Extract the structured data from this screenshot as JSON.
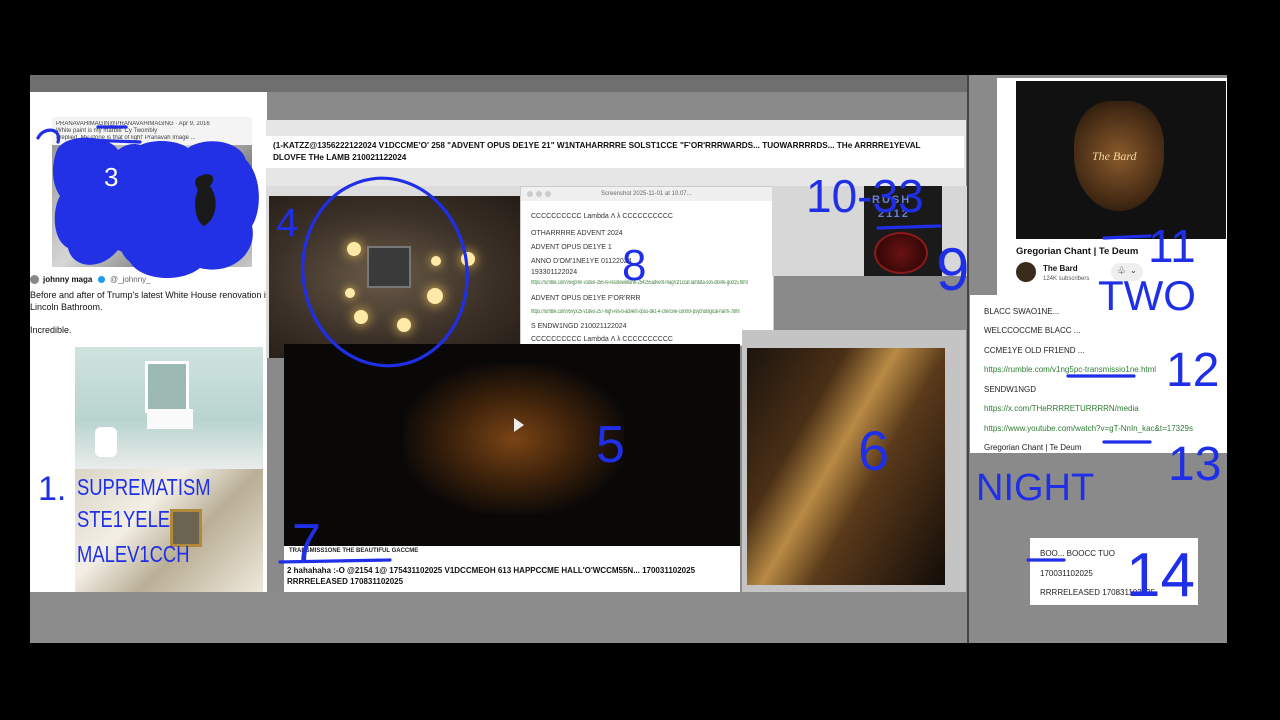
{
  "colors": {
    "ink": "#1f2fe8",
    "background": "#000000",
    "desktop": "#8a8a8a",
    "link": "#2e7d32"
  },
  "tweet_top": {
    "handle_line": "PRANAVAHIMAGIN@PRANAVAHIMAGING · Apr 9, 2016",
    "line1": "White paint is my marble' Cy Twombly",
    "line2": "I replied,  My stone is that of light' Pranavah Image ..."
  },
  "tweet_main": {
    "user": "johnny maga",
    "handle": "@_johnny_",
    "text_line1": "Before and after of Trump's latest White House renovation in",
    "text_line2": "Lincoln Bathroom.",
    "text_line3": "Incredible."
  },
  "suprematism": {
    "line1": "SUPREMATISM",
    "line2": "STE1YELE",
    "line3": "MALEV1CCH"
  },
  "title_banner": {
    "line1": "(1-KATZZ@1356222122024 V1DCCME'O' 258 \"ADVENT OPUS DE1YE 21\" W1NTAHARRRRE SOLST1CCE \"F'OR'RRRWARDS... TUOWARRRRDS... THe ARRRRE1YEVAL",
    "line2": "DLOVFE THe LAMB 210021122024"
  },
  "screenshot_title": "Screenshot 2025-11-01 at 10.07...",
  "notes": [
    {
      "text": "CCCCCCCCCC Lambda Λ λ CCCCCCCCCC",
      "link": false
    },
    {
      "text": "OTHARRRRE ADVENT 2024",
      "link": false
    },
    {
      "text": "ADVENT OPUS DE1YE 1",
      "link": false
    },
    {
      "text": "ANNO D'OM'1NE1YE 01122024",
      "link": false
    },
    {
      "text": "193301122024",
      "link": false
    },
    {
      "text": "https://rumble.com/v5vjpmn-v1deo-256-re-resolewetione-254255advent-magn1f1ccat-lambda-son-dlovfe-god15.html",
      "link": true
    },
    {
      "text": "ADVENT OPUS DE1YE F'OR'RRR",
      "link": false
    },
    {
      "text": "https://rumble.com/v5vyx25-v1deo-257-high-res-b-advent-opus-de1-4-c0ercive-control-psychological-harm-.html",
      "link": true
    },
    {
      "text": "S ENDW1NGD 210021122024",
      "link": false
    },
    {
      "text": "CCCCCCCCCC Lambda Λ λ CCCCCCCCCC",
      "link": false
    }
  ],
  "video": {
    "caption_label": "TRANSMISS1ONE THE BEAUTIFUL GACCME",
    "caption_line1": "2 hahahaha :-O @2154 1@ 175431102025 V1DCCMEOH 613 HAPPCCME HALL'O'WCCM55N... 170031102025",
    "caption_line2": "RRRRELEASED 170831102025"
  },
  "album": {
    "line1": "RUSH",
    "line2": "2112"
  },
  "channel": {
    "title": "Gregorian Chant | Te Deum",
    "name": "The Bard",
    "subscribers": "124K subscribers",
    "logo_text": "The Bard"
  },
  "links_list": [
    {
      "text": "BLACC SWAO1NE...",
      "link": false
    },
    {
      "text": "WELCCOCCME BLACC ...",
      "link": false
    },
    {
      "text": "CCME1YE OLD FR1END ...",
      "link": false
    },
    {
      "text": "https://rumble.com/v1ng5pc-transmissio1ne.html",
      "link": true
    },
    {
      "text": "SENDW1NGD",
      "link": false
    },
    {
      "text": "https://x.com/THeRRRRETURRRRN/media",
      "link": true
    },
    {
      "text": "https://www.youtube.com/watch?v=gT-NnIn_kac&t=17329s",
      "link": true
    },
    {
      "text": "Gregorian Chant | Te Deum",
      "link": false
    }
  ],
  "boo_note": {
    "line1": "BOO... BOOCC TUO",
    "line2": "170031102025",
    "line3": "RRRRELEASED 170831102025"
  },
  "handwriting": {
    "n1": "1.",
    "n3": "3",
    "n4": "4",
    "n5": "5",
    "n6": "6",
    "n7": "7",
    "n8": "8",
    "n9": "9",
    "n10_33": "10-33",
    "n11": "11",
    "two": "TWO",
    "n12": "12",
    "n13": "13",
    "night": "NIGHT",
    "n14": "14"
  }
}
